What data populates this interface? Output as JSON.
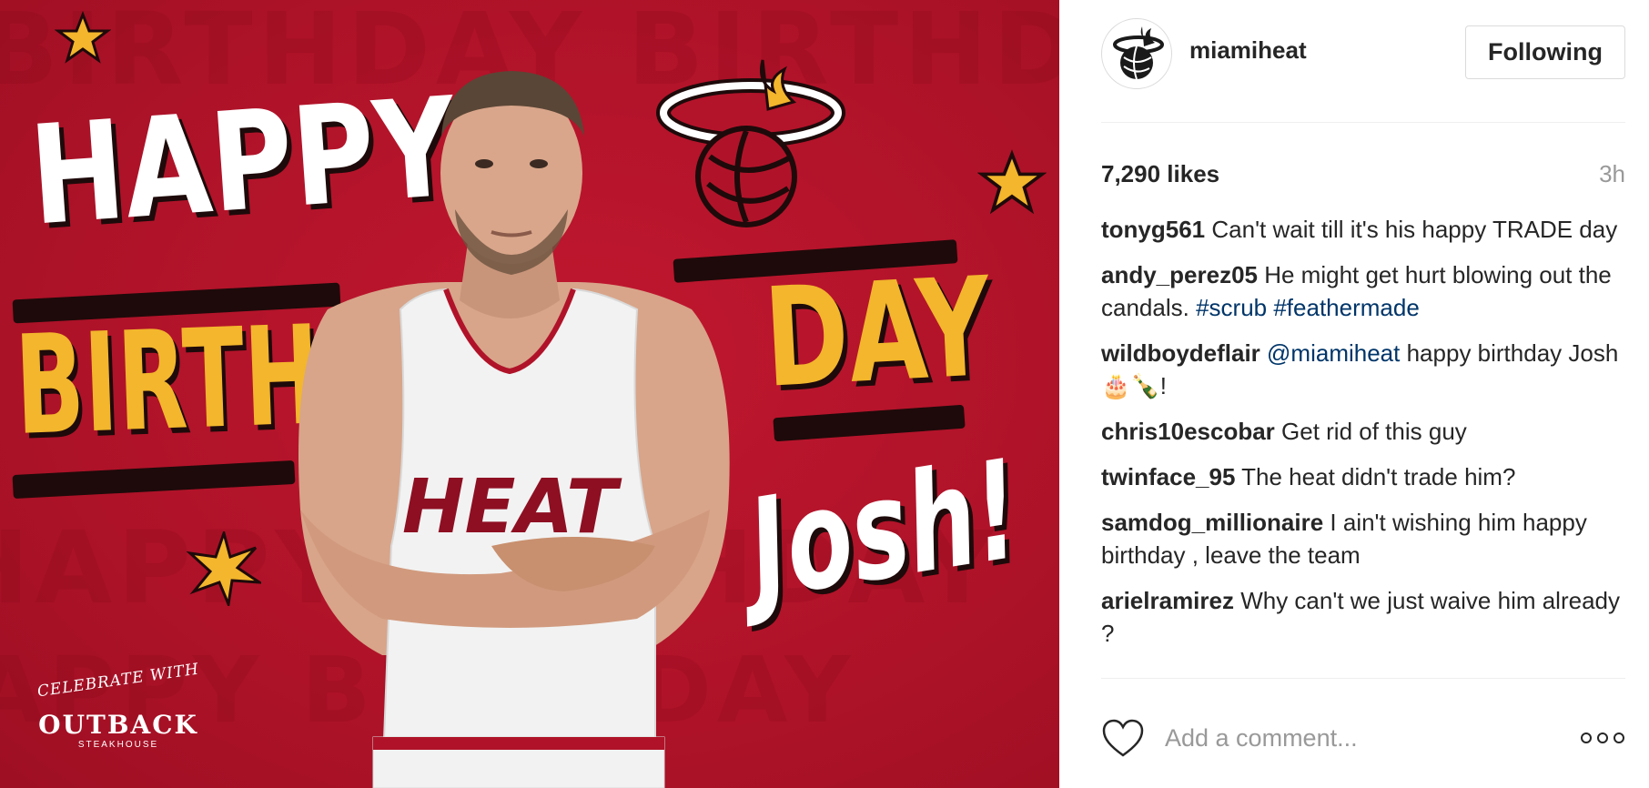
{
  "post_image": {
    "happy": "HAPPY",
    "birth": "BIRTH",
    "day": "DAY",
    "josh": "Josh!",
    "jersey_text": "HEAT",
    "sponsor": {
      "celebrate": "CELEBRATE WITH",
      "brand": "OUTBACK",
      "sub": "STEAKHOUSE"
    },
    "colors": {
      "background": "#b01329",
      "yellow": "#f3b62c",
      "white": "#ffffff",
      "outline": "#1e0a0a"
    }
  },
  "header": {
    "username": "miamiheat",
    "follow_label": "Following",
    "avatar_icon": "miami-heat-logo-icon"
  },
  "likes": "7,290 likes",
  "timestamp": "3h",
  "comments": [
    {
      "user": "tonyg561",
      "text": " Can't wait till it's his happy TRADE day"
    },
    {
      "user": "andy_perez05",
      "text": " He might get hurt blowing out the candals. ",
      "tags": "#scrub #feathermade"
    },
    {
      "user": "wildboydeflair",
      "mention": " @miamiheat",
      "text": " happy birthday Josh 🎂🍾!"
    },
    {
      "user": "chris10escobar",
      "text": " Get rid of this guy"
    },
    {
      "user": "twinface_95",
      "text": " The heat didn't trade him?"
    },
    {
      "user": "samdog_millionaire",
      "text": " I ain't wishing him happy birthday , leave the team"
    },
    {
      "user": "arielramirez",
      "text": " Why can't we just waive him already ?"
    }
  ],
  "comment_box": {
    "placeholder": "Add a comment...",
    "like_icon": "heart-icon",
    "more_icon": "more-options-icon"
  },
  "accent_colors": {
    "link": "#003569",
    "muted": "#999999",
    "text": "#262626"
  }
}
